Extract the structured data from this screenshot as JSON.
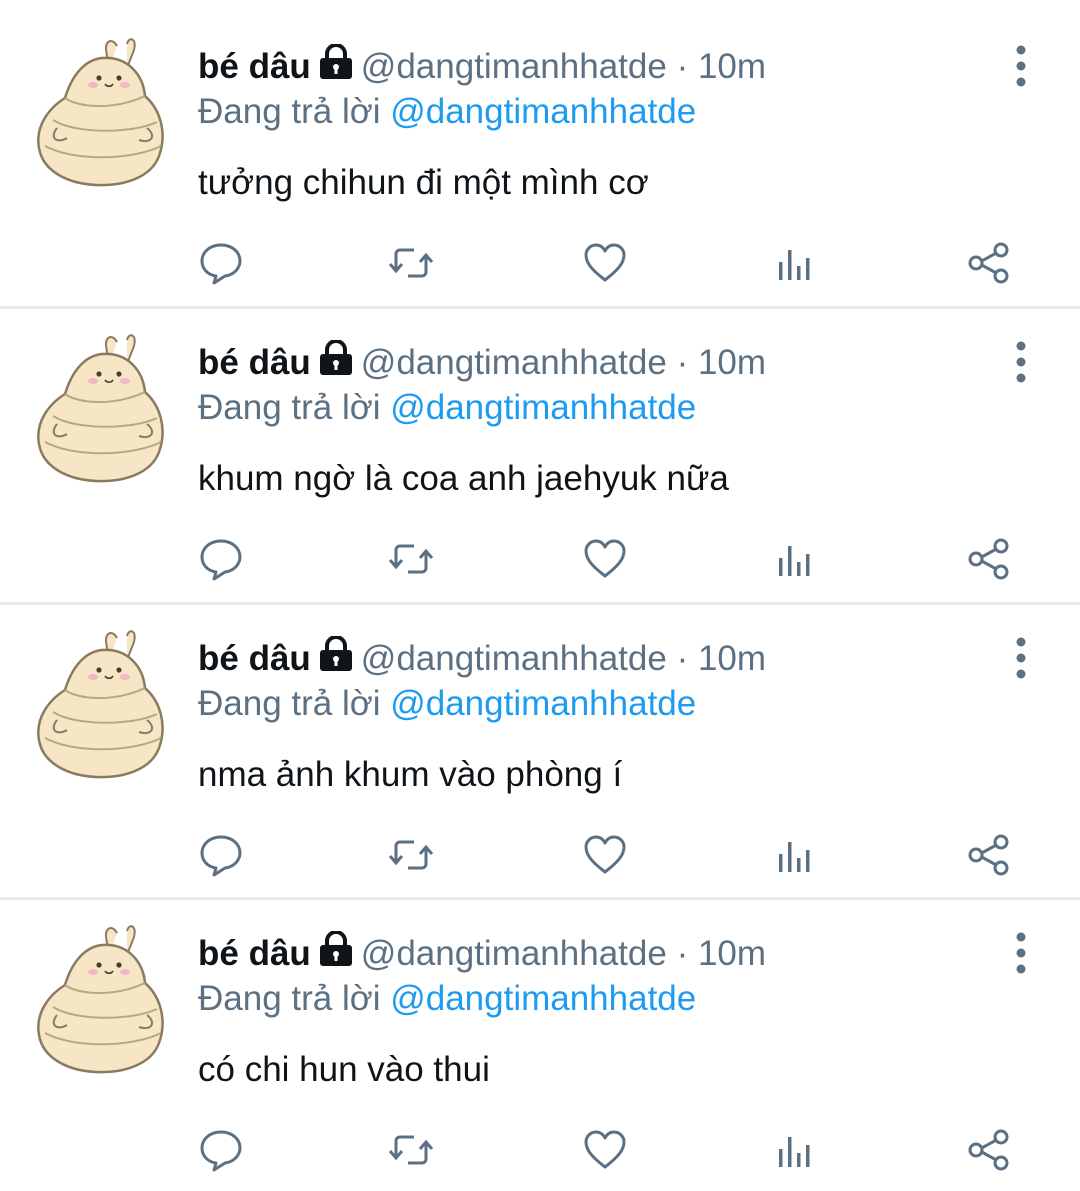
{
  "tweets": [
    {
      "display_name": "bé dâu",
      "handle": "@dangtimanhhatde",
      "separator": "·",
      "time": "10m",
      "reply_prefix": "Đang trả lời",
      "reply_to": "@dangtimanhhatde",
      "text": "tưởng chihun đi một mình cơ"
    },
    {
      "display_name": "bé dâu",
      "handle": "@dangtimanhhatde",
      "separator": "·",
      "time": "10m",
      "reply_prefix": "Đang trả lời",
      "reply_to": "@dangtimanhhatde",
      "text": "khum ngờ là coa anh jaehyuk nữa"
    },
    {
      "display_name": "bé dâu",
      "handle": "@dangtimanhhatde",
      "separator": "·",
      "time": "10m",
      "reply_prefix": "Đang trả lời",
      "reply_to": "@dangtimanhhatde",
      "text": "nma ảnh khum vào phòng í"
    },
    {
      "display_name": "bé dâu",
      "handle": "@dangtimanhhatde",
      "separator": "·",
      "time": "10m",
      "reply_prefix": "Đang trả lời",
      "reply_to": "@dangtimanhhatde",
      "text": "có chi hun vào thui"
    }
  ],
  "icons": {
    "reply": "reply-icon",
    "retweet": "retweet-icon",
    "like": "heart-icon",
    "views": "analytics-icon",
    "share": "share-icon",
    "more": "more-vertical-icon",
    "lock": "lock-icon"
  },
  "colors": {
    "name": "#0f1419",
    "secondary": "#5b7083",
    "link": "#1d9bf0",
    "divider": "#e9ecef",
    "icon": "#5b7083",
    "avatar_body": "#f6e6c6",
    "avatar_outline": "#8a7a5f"
  }
}
